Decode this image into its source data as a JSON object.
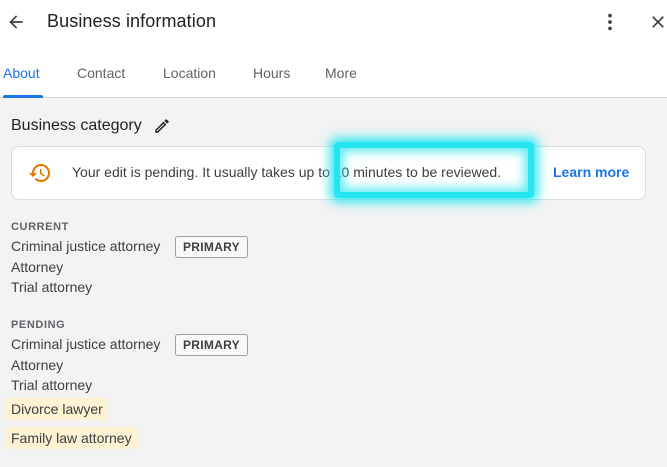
{
  "header": {
    "title": "Business information"
  },
  "tabs": [
    {
      "label": "About"
    },
    {
      "label": "Contact"
    },
    {
      "label": "Location"
    },
    {
      "label": "Hours"
    },
    {
      "label": "More"
    }
  ],
  "active_tab": "About",
  "section": {
    "title": "Business category"
  },
  "notice": {
    "text": "Your edit is pending. It usually takes up to 10 minutes to be reviewed.",
    "link": "Learn more",
    "highlighted_phrase": "10 minutes to be reviewed."
  },
  "current": {
    "label": "CURRENT",
    "items": [
      {
        "name": "Criminal justice attorney",
        "badge": "PRIMARY"
      },
      {
        "name": "Attorney"
      },
      {
        "name": "Trial attorney"
      }
    ]
  },
  "pending": {
    "label": "PENDING",
    "items": [
      {
        "name": "Criminal justice attorney",
        "badge": "PRIMARY"
      },
      {
        "name": "Attorney"
      },
      {
        "name": "Trial attorney"
      },
      {
        "name": "Divorce lawyer",
        "added": true
      },
      {
        "name": "Family law attorney",
        "added": true
      }
    ]
  },
  "colors": {
    "accent": "#1a73e8",
    "pending_icon": "#e37400",
    "added_highlight": "#fdf2d2",
    "annotation_glow": "#25e6f0"
  },
  "icons": {
    "back": "arrow-back-icon",
    "more": "more-vert-icon",
    "close": "close-icon",
    "edit": "pencil-icon",
    "pending": "clock-history-icon"
  }
}
